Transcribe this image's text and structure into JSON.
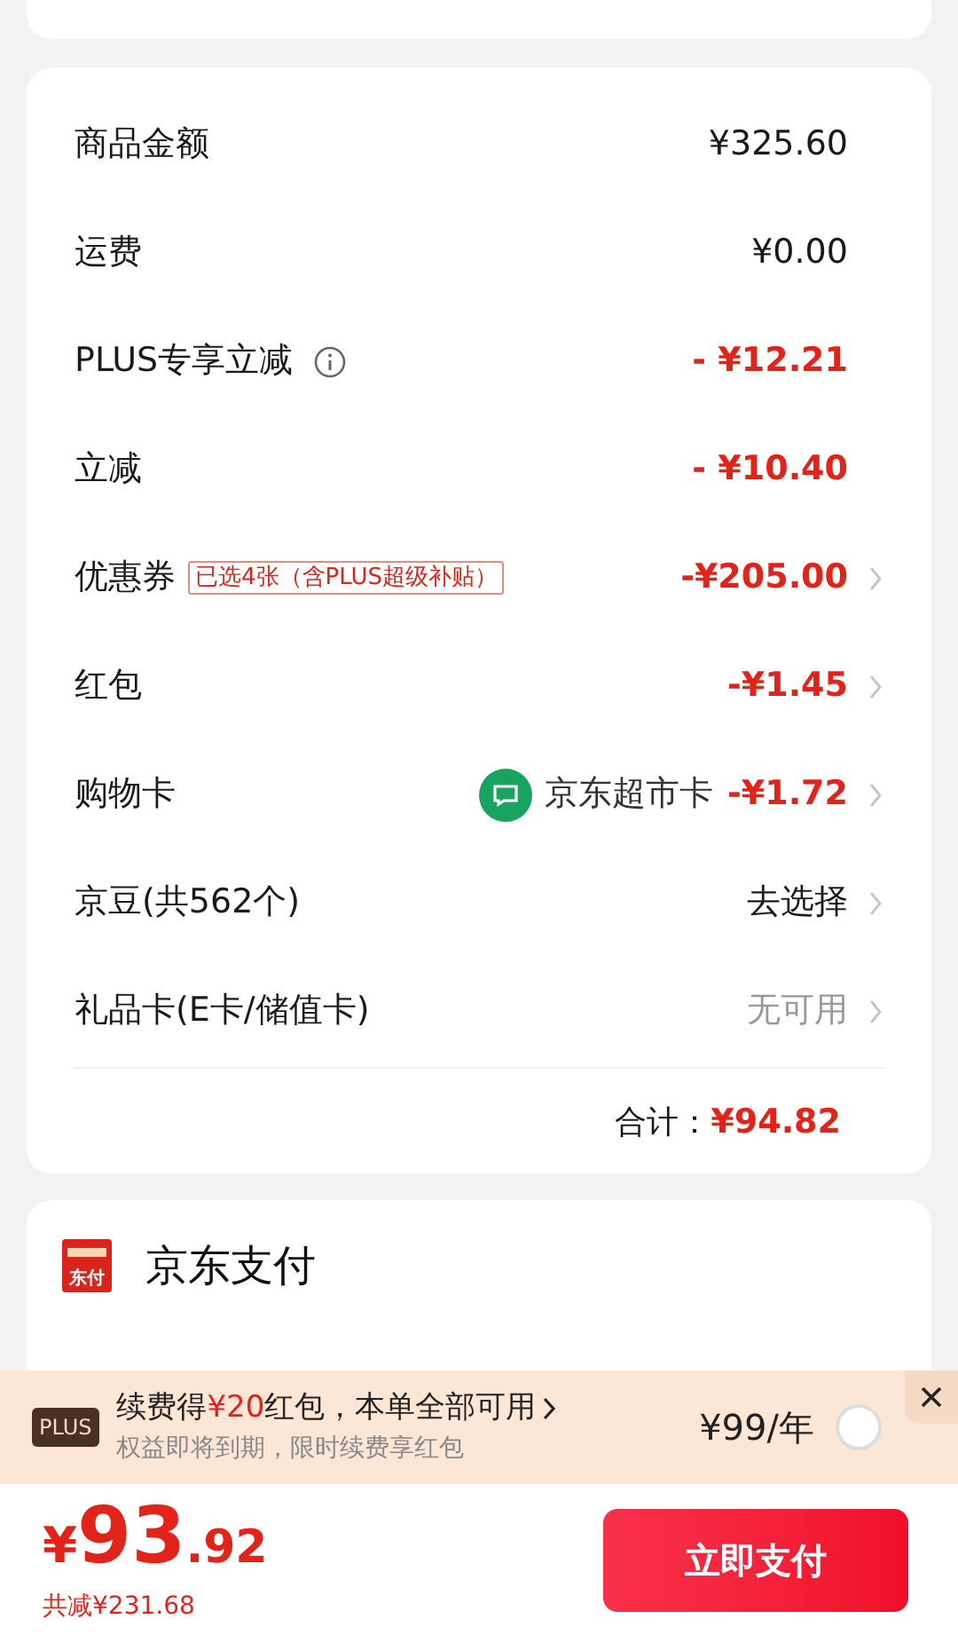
{
  "summary": {
    "rows": [
      {
        "label": "商品金额",
        "value": "¥325.60",
        "kind": "plain",
        "arrow": false
      },
      {
        "label": "运费",
        "value": "¥0.00",
        "kind": "plain",
        "arrow": false
      },
      {
        "label": "PLUS专享立减",
        "value": "- ¥12.21",
        "kind": "discount",
        "arrow": false,
        "info": true
      },
      {
        "label": "立减",
        "value": "- ¥10.40",
        "kind": "discount",
        "arrow": false
      },
      {
        "label": "优惠券",
        "tag": "已选4张（含PLUS超级补贴）",
        "value": "-¥205.00",
        "kind": "discount",
        "arrow": true
      },
      {
        "label": "红包",
        "value": "-¥1.45",
        "kind": "discount",
        "arrow": true
      },
      {
        "label": "购物卡",
        "card_name": "京东超市卡",
        "value": "-¥1.72",
        "kind": "discount",
        "arrow": true
      },
      {
        "label": "京豆(共562个)",
        "value": "去选择",
        "kind": "plain",
        "arrow": true
      },
      {
        "label": "礼品卡(E卡/储值卡)",
        "value": "无可用",
        "kind": "muted",
        "arrow": true
      }
    ],
    "total_label": "合计：",
    "total_value": "¥94.82"
  },
  "payment": {
    "icon_text": "东付",
    "title": "京东支付"
  },
  "plus_banner": {
    "badge": "PLUS",
    "title_parts": [
      {
        "text": "续费得",
        "highlight": false
      },
      {
        "text": "¥20",
        "highlight": true
      },
      {
        "text": "红包，本单全部可用",
        "highlight": false
      }
    ],
    "subtitle": "权益即将到期，限时续费享红包",
    "price": "¥99/年",
    "checked": false
  },
  "footer": {
    "currency": "¥",
    "amount_int": "93",
    "amount_dec": ".92",
    "saving": "共减¥231.68",
    "pay_button": "立即支付"
  }
}
